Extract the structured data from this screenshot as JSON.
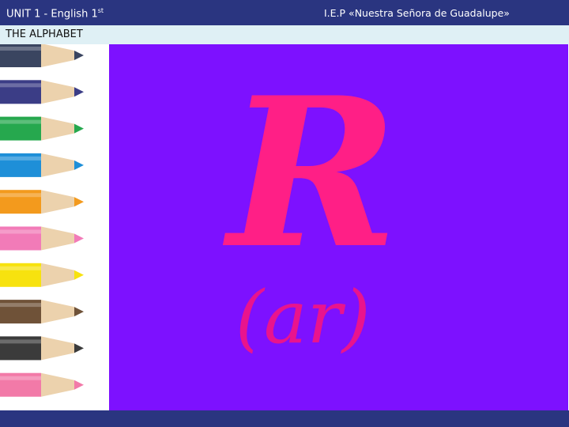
{
  "header": {
    "unit_title": "UNIT 1 - English 1",
    "unit_ordinal_suffix": "st",
    "school_name": "I.E.P «Nuestra Señora de Guadalupe»"
  },
  "subheader": {
    "section_title": "THE ALPHABET"
  },
  "slide": {
    "letter": "R",
    "pronunciation": "(ar)"
  },
  "colors": {
    "header_bar": "#2a3580",
    "subheader_bar": "#dff0f5",
    "letter_panel": "#7d11ff",
    "letter_color": "#ff1f86"
  },
  "pencils": {
    "icon": "colored-pencils",
    "colors": [
      "#3a4560",
      "#3b3d86",
      "#26a84e",
      "#1e8fd8",
      "#f39a1d",
      "#f27bb8",
      "#f7e20f",
      "#6f5238",
      "#3b3b3b",
      "#f27aa8"
    ]
  }
}
